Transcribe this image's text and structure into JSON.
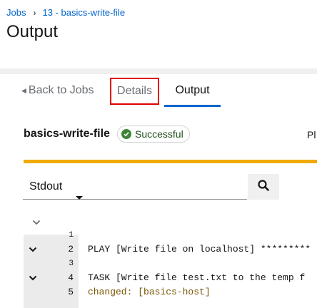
{
  "breadcrumb": {
    "root": "Jobs",
    "separator": "›",
    "current": "13 - basics-write-file"
  },
  "page": {
    "title": "Output"
  },
  "tabs": {
    "back": "Back to Jobs",
    "details": "Details",
    "output": "Output"
  },
  "job": {
    "name": "basics-write-file",
    "status": "Successful",
    "truncated_label": "Pl"
  },
  "colors": {
    "accent": "#06c",
    "success": "#3e8635",
    "progress": "#f0ab00",
    "highlight_border": "#e00000"
  },
  "toolbar": {
    "select_value": "Stdout",
    "search_value": "",
    "search_icon": "search-icon"
  },
  "output": {
    "lines": [
      {
        "num": "1",
        "text": "",
        "toggle": false
      },
      {
        "num": "2",
        "text": "PLAY [Write file on localhost] *********",
        "toggle": true
      },
      {
        "num": "3",
        "text": "",
        "toggle": false
      },
      {
        "num": "4",
        "text": "TASK [Write file test.txt to the temp f",
        "toggle": true
      },
      {
        "num": "5",
        "text": "changed: [basics-host]",
        "toggle": false,
        "style": "changed"
      }
    ]
  }
}
